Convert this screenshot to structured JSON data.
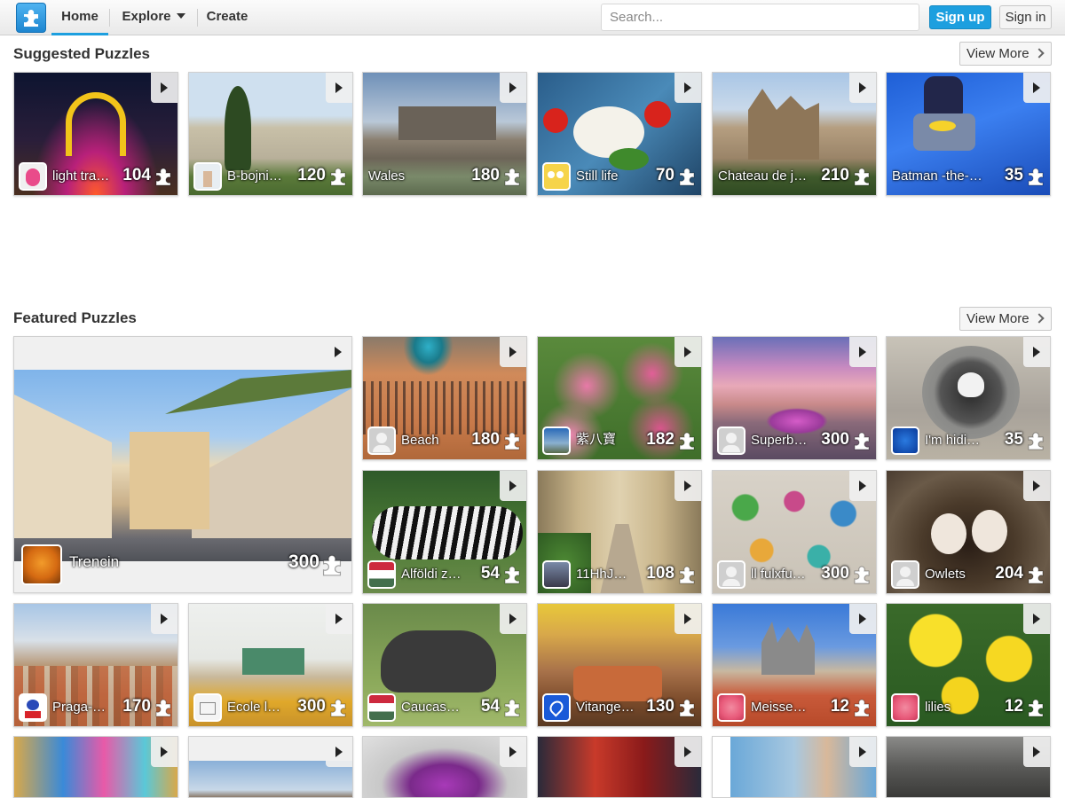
{
  "nav": {
    "home": "Home",
    "explore": "Explore",
    "create": "Create",
    "search_placeholder": "Search...",
    "signup": "Sign up",
    "signin": "Sign in"
  },
  "icons": {
    "logo": "puzzle-logo-icon",
    "piece": "puzzle-piece-icon",
    "play": "play-icon",
    "chevron": "chevron-right-icon"
  },
  "colors": {
    "accent": "#1d9fdf",
    "header_bg": "#efefef",
    "text": "#333333"
  },
  "suggested": {
    "title": "Suggested Puzzles",
    "view_more": "View More",
    "puzzles": [
      {
        "title": "light tra…",
        "count": "104"
      },
      {
        "title": "B-bojni…",
        "count": "120"
      },
      {
        "title": "Wales",
        "count": "180"
      },
      {
        "title": "Still life",
        "count": "70"
      },
      {
        "title": "Chateau de j…",
        "count": "210"
      },
      {
        "title": "Batman -the-br…",
        "count": "35"
      }
    ]
  },
  "featured": {
    "title": "Featured Puzzles",
    "view_more": "View More",
    "main": {
      "title": "Trencin",
      "count": "300"
    },
    "puzzles": [
      {
        "title": "Beach",
        "count": "180"
      },
      {
        "title": "紫八寶",
        "count": "182"
      },
      {
        "title": "Superb…",
        "count": "300"
      },
      {
        "title": "I'm hidin…",
        "count": "35"
      },
      {
        "title": "Alföldi ze…",
        "count": "54"
      },
      {
        "title": "11HhJ…",
        "count": "108"
      },
      {
        "title": "ll fulxfu…",
        "count": "300"
      },
      {
        "title": "Owlets",
        "count": "204"
      },
      {
        "title": "Praga-…",
        "count": "170"
      },
      {
        "title": "Ecole l…",
        "count": "300"
      },
      {
        "title": "Caucasi…",
        "count": "54"
      },
      {
        "title": "Vitange…",
        "count": "130"
      },
      {
        "title": "Meissen…",
        "count": "12"
      },
      {
        "title": "lilies",
        "count": "12"
      }
    ]
  }
}
